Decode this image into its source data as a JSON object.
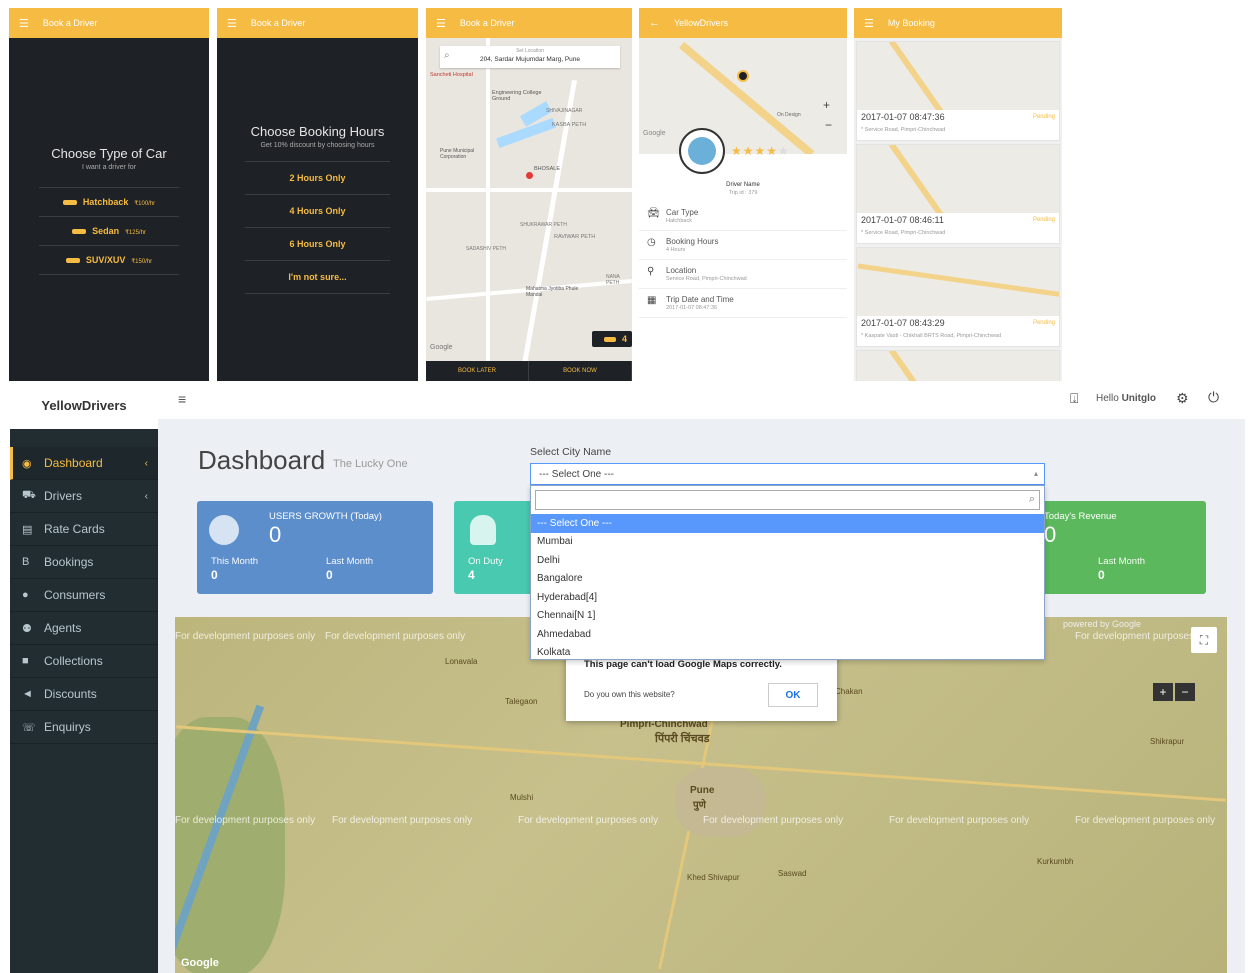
{
  "phone1": {
    "appbar_title": "Book a Driver",
    "heading": "Choose Type of Car",
    "subheading": "I want a driver for",
    "options": [
      {
        "label": "Hatchback",
        "price": "₹100/hr"
      },
      {
        "label": "Sedan",
        "price": "₹125/hr"
      },
      {
        "label": "SUV/XUV",
        "price": "₹150/hr"
      }
    ]
  },
  "phone2": {
    "appbar_title": "Book a Driver",
    "heading": "Choose Booking Hours",
    "subheading": "Get 10% discount by choosing hours",
    "options": [
      "2 Hours Only",
      "4 Hours Only",
      "6 Hours Only",
      "I'm not sure..."
    ]
  },
  "phone3": {
    "appbar_title": "Book a Driver",
    "location_label": "Set Location",
    "location_value": "204, Sardar Mujumdar Marg, Pune",
    "places": [
      "Sancheti Hospital",
      "Engineering College Ground",
      "KASBA PETH",
      "SHIVAJINAGAR",
      "Pune Municipal Corporation",
      "BHOSALE",
      "SHUKRAWAR PETH",
      "RAVIWAR PETH",
      "SADASHIV PETH",
      "NANA PETH",
      "Mahatma Jyotiba Phule Mandai"
    ],
    "car_count": "4",
    "google": "Google",
    "book_later": "BOOK LATER",
    "book_now": "BOOK NOW"
  },
  "phone4": {
    "appbar_title": "YellowDrivers",
    "map_label": "On Design",
    "google": "Google",
    "driver_name": "Driver Name",
    "driver_sub": "Trip id : 379",
    "rows": [
      {
        "title": "Car Type",
        "sub": "Hatchback"
      },
      {
        "title": "Booking Hours",
        "sub": "4 Hours"
      },
      {
        "title": "Location",
        "sub": "Service Road, Pimpri-Chinchwad"
      },
      {
        "title": "Trip Date and Time",
        "sub": "2017-01-07 08:47:36"
      }
    ]
  },
  "phone5": {
    "appbar_title": "My Booking",
    "bookings": [
      {
        "date": "2017-01-07 08:47:36",
        "status": "Pending",
        "address": "* Service Road, Pimpri-Chinchwad"
      },
      {
        "date": "2017-01-07 08:46:11",
        "status": "Pending",
        "address": "* Service Road, Pimpri-Chinchwad"
      },
      {
        "date": "2017-01-07 08:43:29",
        "status": "Pending",
        "address": "* Kaspate Vasti - Chikhali BRTS Road, Pimpri-Chinchwad"
      }
    ]
  },
  "dashboard": {
    "brand": "YellowDrivers",
    "user_greeting": "Hello",
    "user_name": "Unitglo",
    "nav": [
      {
        "label": "Dashboard",
        "icon": "dashboard-icon"
      },
      {
        "label": "Drivers",
        "icon": "car-icon"
      },
      {
        "label": "Rate Cards",
        "icon": "card-icon"
      },
      {
        "label": "Bookings",
        "icon": "bookings-icon"
      },
      {
        "label": "Consumers",
        "icon": "user-icon"
      },
      {
        "label": "Agents",
        "icon": "users-icon"
      },
      {
        "label": "Collections",
        "icon": "collections-icon"
      },
      {
        "label": "Discounts",
        "icon": "discount-icon"
      },
      {
        "label": "Enquirys",
        "icon": "phone-icon"
      }
    ],
    "page_title": "Dashboard",
    "page_subtitle": "The Lucky One",
    "select_label": "Select City Name",
    "select_value": "--- Select One ---",
    "dropdown_options": [
      "--- Select One ---",
      "Mumbai",
      "Delhi",
      "Bangalore",
      "Hyderabad[4]",
      "Chennai[N 1]",
      "Ahmedabad",
      "Kolkata"
    ],
    "cards": {
      "users": {
        "title": "USERS GROWTH (Today)",
        "value": "0",
        "this_month_label": "This Month",
        "this_month": "0",
        "last_month_label": "Last Month",
        "last_month": "0"
      },
      "drivers": {
        "label": "On Duty",
        "value": "4"
      },
      "revenue": {
        "title": "Today's Revenue",
        "value": "0",
        "last_month_label": "Last Month",
        "last_month": "0"
      }
    },
    "map": {
      "watermark": "For development purposes only",
      "cities": [
        "Pimpri-Chinchwad",
        "पिंपरी चिंचवड",
        "Pune",
        "पुणे",
        "Lonavala",
        "Talegaon",
        "Chakan",
        "Shikrapur",
        "Mulshi",
        "Khed Shivapur",
        "Saswad",
        "Kurkumbh"
      ],
      "alert_title": "This page can't load Google Maps correctly.",
      "alert_question": "Do you own this website?",
      "alert_ok": "OK",
      "powered_by": "powered by Google",
      "google": "Google"
    },
    "colors": {
      "accent": "#f6bb42",
      "sidebar": "#222d32",
      "blue_card": "#5b8ecb",
      "teal_card": "#48c9b0",
      "green_card": "#5cb85c"
    }
  }
}
